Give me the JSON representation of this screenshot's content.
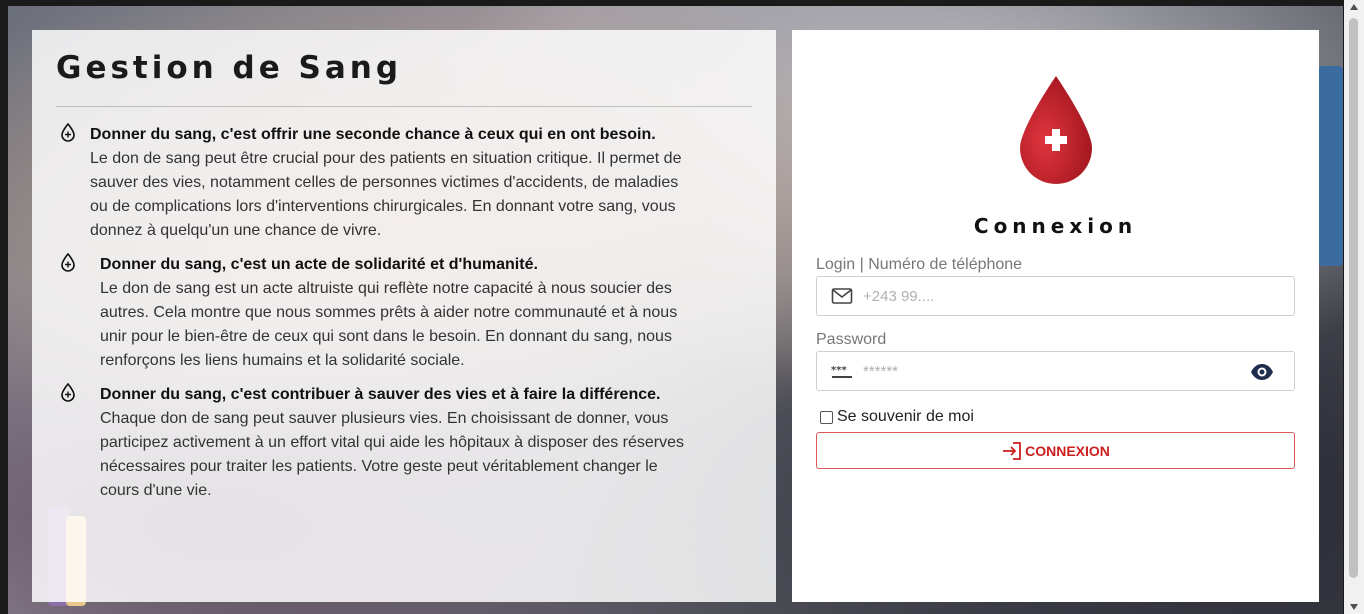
{
  "info": {
    "title": "Gestion de Sang",
    "items": [
      {
        "heading": "Donner du sang, c'est offrir une seconde chance à ceux qui en ont besoin.",
        "text": "Le don de sang peut être crucial pour des patients en situation critique. Il permet de sauver des vies, notamment celles de personnes victimes d'accidents, de maladies ou de complications lors d'interventions chirurgicales. En donnant votre sang, vous donnez à quelqu'un une chance de vivre."
      },
      {
        "heading": "Donner du sang, c'est un acte de solidarité et d'humanité.",
        "text": "Le don de sang est un acte altruiste qui reflète notre capacité à nous soucier des autres. Cela montre que nous sommes prêts à aider notre communauté et à nous unir pour le bien-être de ceux qui sont dans le besoin. En donnant du sang, nous renforçons les liens humains et la solidarité sociale."
      },
      {
        "heading": "Donner du sang, c'est contribuer à sauver des vies et à faire la différence.",
        "text": "Chaque don de sang peut sauver plusieurs vies. En choisissant de donner, vous participez activement à un effort vital qui aide les hôpitaux à disposer des réserves nécessaires pour traiter les patients. Votre geste peut véritablement changer le cours d'une vie."
      }
    ]
  },
  "login": {
    "title": "Connexion",
    "login_label": "Login | Numéro de téléphone",
    "login_placeholder": "+243 99....",
    "password_label": "Password",
    "password_placeholder": "******",
    "remember_label": "Se souvenir de moi",
    "button_label": "CONNEXION"
  },
  "icons": {
    "logo": "blood-drop-cross-icon",
    "item": "blood-drop-icon",
    "email": "envelope-icon",
    "password": "password-dots-icon",
    "eye": "eye-icon",
    "login": "sign-in-icon"
  },
  "colors": {
    "brand_red": "#cc1f1f",
    "drop_red": "#c8202a"
  }
}
